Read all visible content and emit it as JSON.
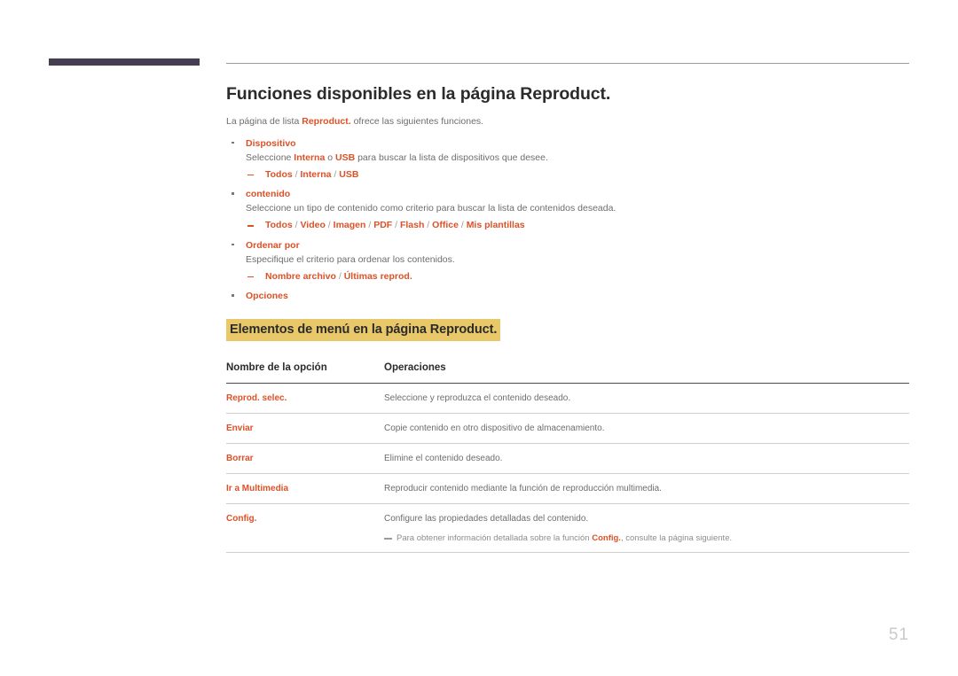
{
  "document": {
    "page_number": "51",
    "title": "Funciones disponibles en la página Reproduct.",
    "intro": {
      "before": "La página de lista ",
      "accent": "Reproduct.",
      "after": " ofrece las siguientes funciones."
    }
  },
  "bullets": [
    {
      "title": "Dispositivo",
      "desc": {
        "part1": "Seleccione ",
        "accent1": "Interna",
        "part2": " o ",
        "accent2": "USB",
        "part3": " para buscar la lista de dispositivos que desee."
      },
      "options": [
        "Todos",
        "Interna",
        "USB"
      ]
    },
    {
      "title": "contenido",
      "desc": {
        "part1": "Seleccione un tipo de contenido como criterio para buscar la lista de contenidos deseada.",
        "accent1": "",
        "part2": "",
        "accent2": "",
        "part3": ""
      },
      "options": [
        "Todos",
        "Video",
        "Imagen",
        "PDF",
        "Flash",
        "Office",
        "Mis plantillas"
      ]
    },
    {
      "title": "Ordenar por",
      "desc": {
        "part1": "Especifique el criterio para ordenar los contenidos.",
        "accent1": "",
        "part2": "",
        "accent2": "",
        "part3": ""
      },
      "options": [
        "Nombre archivo",
        "Últimas reprod."
      ]
    },
    {
      "title": "Opciones",
      "desc": null,
      "options": []
    }
  ],
  "section": {
    "heading": "Elementos de menú en la página Reproduct."
  },
  "table": {
    "headers": [
      "Nombre de la opción",
      "Operaciones"
    ],
    "rows": [
      {
        "option": "Reprod. selec.",
        "operation": "Seleccione y reproduzca el contenido deseado.",
        "note": null
      },
      {
        "option": "Enviar",
        "operation": "Copie contenido en otro dispositivo de almacenamiento.",
        "note": null
      },
      {
        "option": "Borrar",
        "operation": "Elimine el contenido deseado.",
        "note": null
      },
      {
        "option": "Ir a Multimedia",
        "operation": "Reproducir contenido mediante la función de reproducción multimedia.",
        "note": null
      },
      {
        "option": "Config.",
        "operation": "Configure las propiedades detalladas del contenido.",
        "note": {
          "before": "Para obtener información detallada sobre la función ",
          "accent": "Config.",
          "after": ", consulte la página siguiente."
        }
      }
    ]
  },
  "colors": {
    "accent_orange": "#dd5127",
    "highlight_gold": "#e8c869",
    "corner_bar": "#453d52",
    "body_text": "#6d6d6d",
    "heading_text": "#2b2b2b",
    "page_number": "#c9c9ce"
  }
}
